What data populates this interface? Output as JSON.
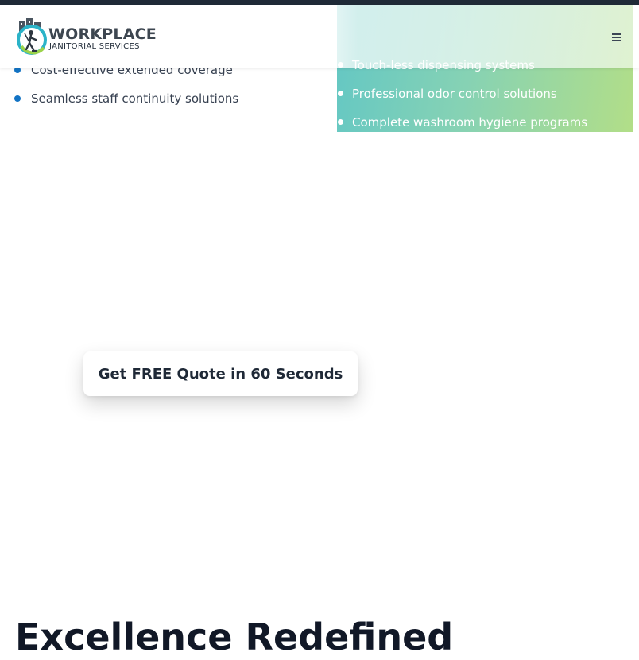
{
  "brand": {
    "name": "WORKPLACE",
    "tagline": "JANITORIAL SERVICES",
    "colors": {
      "ring": "#2bb3c8",
      "accent": "#9bd34a",
      "text": "#3d4650"
    }
  },
  "header": {
    "menu_icon": "hamburger-menu-icon"
  },
  "left_list": {
    "items": [
      "Cost-effective extended coverage",
      "Seamless staff continuity solutions"
    ],
    "bullet_color": "#1273c4"
  },
  "green_card": {
    "items": [
      "Touch-less dispensing systems",
      "Professional odor control solutions",
      "Complete washroom hygiene programs"
    ],
    "gradient": [
      "#63c7c4",
      "#86d2b4",
      "#b2de88"
    ]
  },
  "cta": {
    "label": "Get FREE Quote in 60 Seconds"
  },
  "section": {
    "heading": "Excellence Redefined"
  }
}
